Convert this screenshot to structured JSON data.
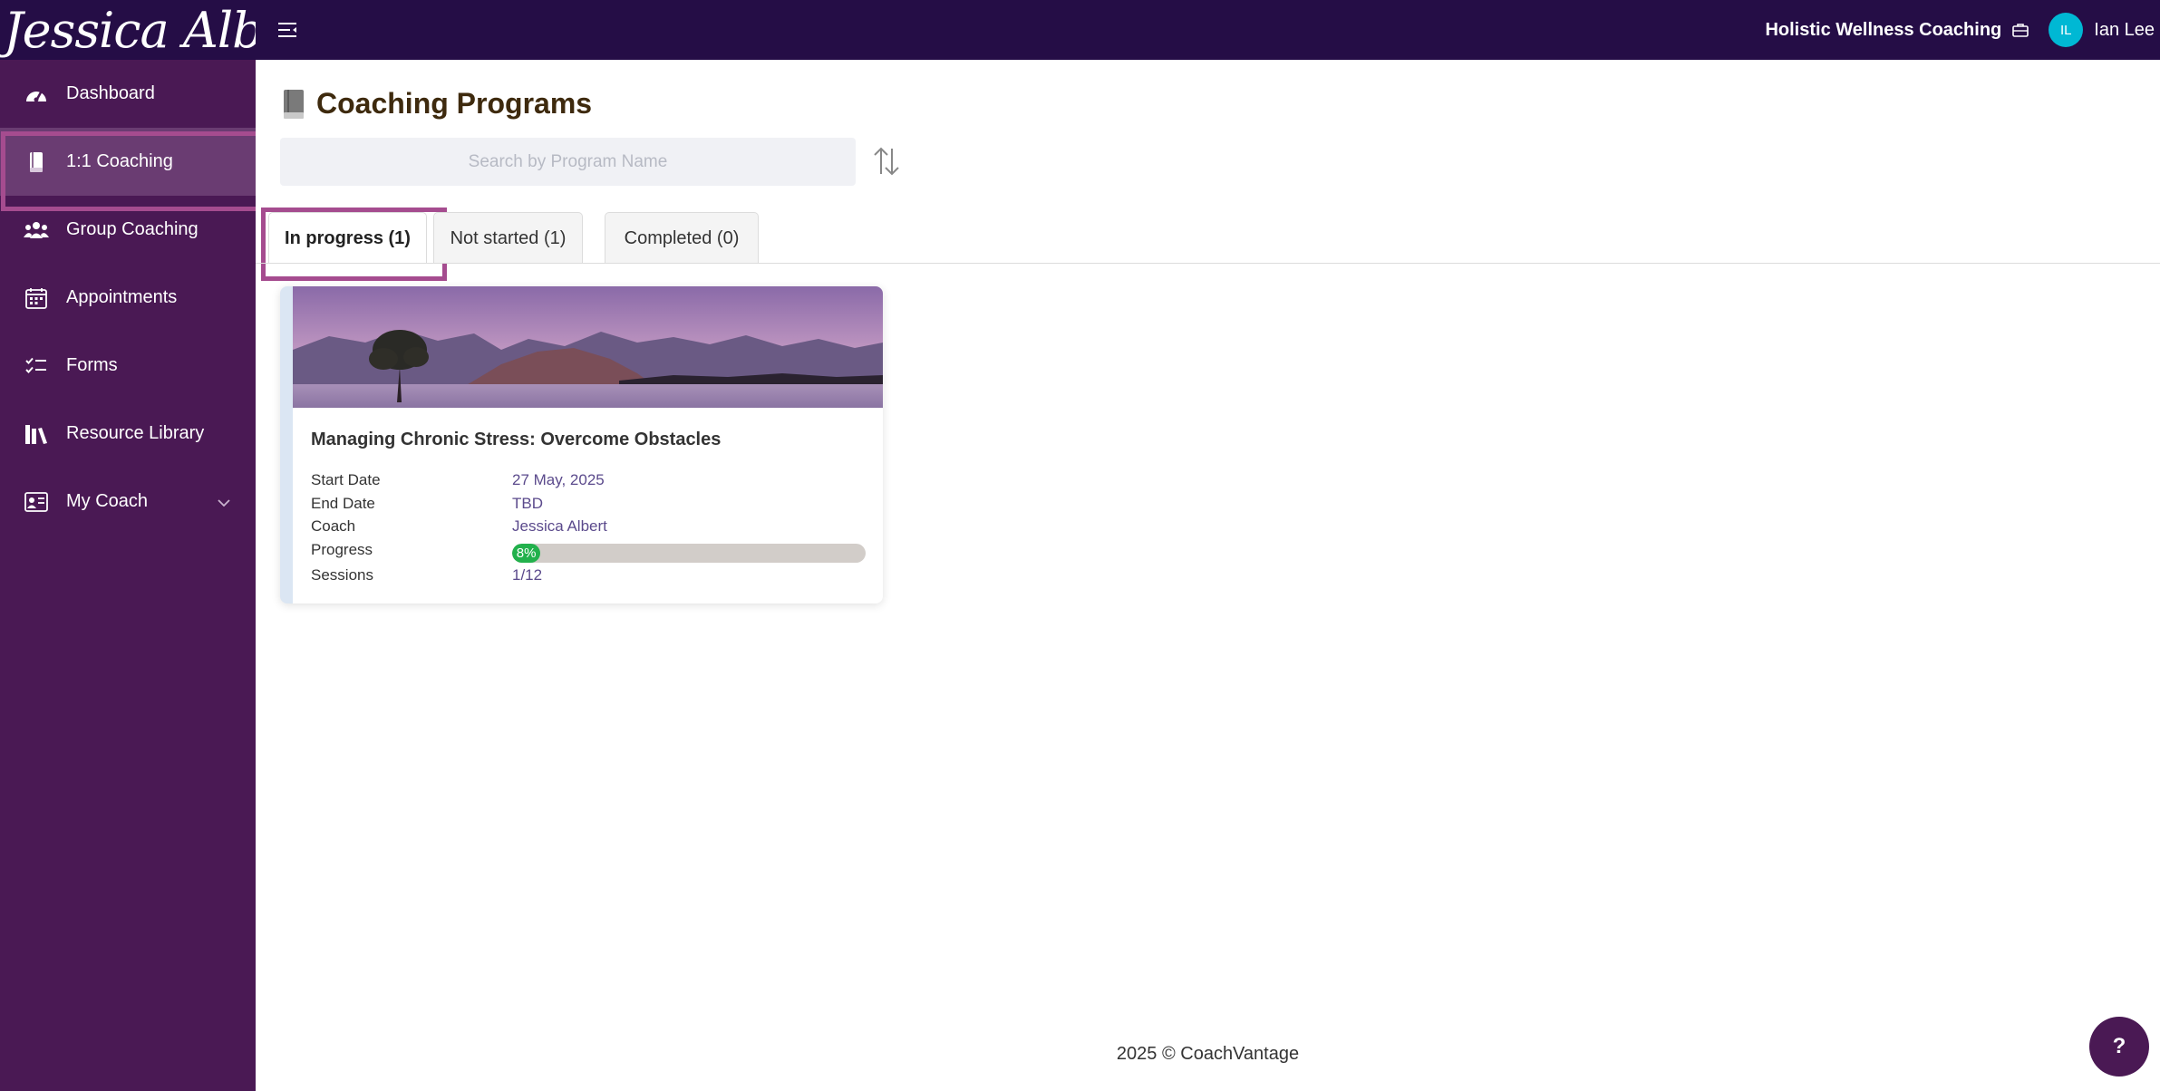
{
  "brand": {
    "name": "Jessica Albert"
  },
  "topbar": {
    "org_name": "Holistic Wellness Coaching",
    "user_initials": "IL",
    "user_name": "Ian Lee"
  },
  "sidebar": {
    "items": [
      {
        "label": "Dashboard",
        "icon": "gauge-icon"
      },
      {
        "label": "1:1 Coaching",
        "icon": "book-icon",
        "active": true
      },
      {
        "label": "Group Coaching",
        "icon": "group-icon"
      },
      {
        "label": "Appointments",
        "icon": "calendar-icon"
      },
      {
        "label": "Forms",
        "icon": "checklist-icon"
      },
      {
        "label": "Resource Library",
        "icon": "library-icon"
      },
      {
        "label": "My Coach",
        "icon": "coach-icon",
        "expandable": true
      }
    ]
  },
  "page": {
    "title": "Coaching Programs",
    "search_placeholder": "Search by Program Name"
  },
  "tabs": [
    {
      "label": "In progress (1)",
      "active": true
    },
    {
      "label": "Not started (1)"
    },
    {
      "label": "Completed (0)"
    }
  ],
  "program": {
    "title": "Managing Chronic Stress: Overcome Obstacles",
    "fields": [
      {
        "key": "Start Date",
        "value": "27 May, 2025"
      },
      {
        "key": "End Date",
        "value": "TBD"
      },
      {
        "key": "Coach",
        "value": "Jessica Albert"
      },
      {
        "key": "Progress",
        "value": "8%"
      },
      {
        "key": "Sessions",
        "value": "1/12"
      }
    ],
    "progress_fraction": 0.08
  },
  "footer": {
    "text": "2025 © CoachVantage"
  },
  "help": {
    "label": "?"
  },
  "colors": {
    "topbar": "#250d46",
    "sidebar": "#4a1954",
    "highlight": "#a54c8f",
    "progress": "#22b14c",
    "avatar": "#00b8d4"
  }
}
